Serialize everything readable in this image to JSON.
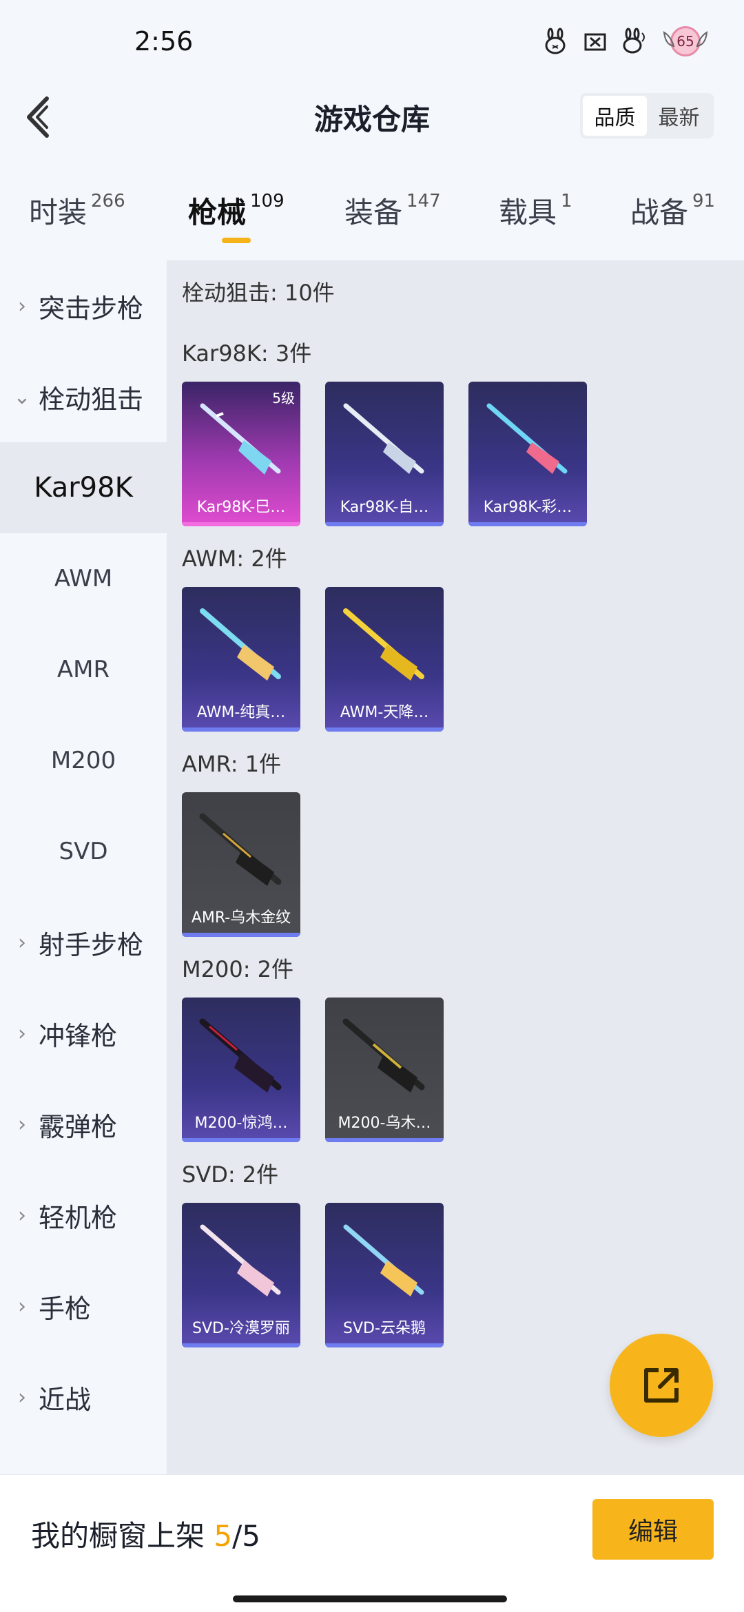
{
  "status_bar": {
    "time": "2:56",
    "level": "65"
  },
  "header": {
    "title": "游戏仓库",
    "sort_options": [
      "品质",
      "最新"
    ],
    "sort_active": "品质"
  },
  "tabs": [
    {
      "label": "时装",
      "count": "266"
    },
    {
      "label": "枪械",
      "count": "109"
    },
    {
      "label": "装备",
      "count": "147"
    },
    {
      "label": "载具",
      "count": "1"
    },
    {
      "label": "战备",
      "count": "91"
    }
  ],
  "sidebar": {
    "items": [
      {
        "label": "突击步枪"
      },
      {
        "label": "栓动狙击"
      },
      {
        "label": "Kar98K"
      },
      {
        "label": "AWM"
      },
      {
        "label": "AMR"
      },
      {
        "label": "M200"
      },
      {
        "label": "SVD"
      },
      {
        "label": "射手步枪"
      },
      {
        "label": "冲锋枪"
      },
      {
        "label": "霰弹枪"
      },
      {
        "label": "轻机枪"
      },
      {
        "label": "手枪"
      },
      {
        "label": "近战"
      }
    ]
  },
  "main": {
    "summary": "栓动狙击: 10件",
    "sections": [
      {
        "title": "Kar98K: 3件",
        "items": [
          {
            "name": "Kar98K-巳…",
            "level": "5级"
          },
          {
            "name": "Kar98K-自…"
          },
          {
            "name": "Kar98K-彩…"
          }
        ]
      },
      {
        "title": "AWM: 2件",
        "items": [
          {
            "name": "AWM-纯真…"
          },
          {
            "name": "AWM-天降…"
          }
        ]
      },
      {
        "title": "AMR: 1件",
        "items": [
          {
            "name": "AMR-乌木金纹"
          }
        ]
      },
      {
        "title": "M200: 2件",
        "items": [
          {
            "name": "M200-惊鸿…"
          },
          {
            "name": "M200-乌木…"
          }
        ]
      },
      {
        "title": "SVD: 2件",
        "items": [
          {
            "name": "SVD-冷漠罗丽"
          },
          {
            "name": "SVD-云朵鹅"
          }
        ]
      }
    ]
  },
  "bottom": {
    "showcase_label": "我的橱窗上架",
    "showcase_count": "5",
    "showcase_total": "/5",
    "edit_label": "编辑"
  },
  "colors": {
    "accent": "#f7b51b",
    "rare_purple": "#3a3586",
    "legendary_pink": "#e14cd0",
    "common_gray": "#4b4d53"
  }
}
